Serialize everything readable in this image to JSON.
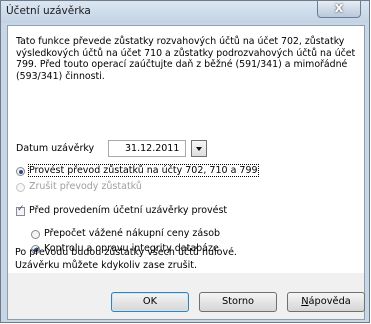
{
  "window": {
    "title": "Účetní uzávěrka",
    "close_glyph": "X"
  },
  "intro_text": "Tato funkce převede zůstatky rozvahových účtů na účet 702, zůstatky výsledkových účtů na účet 710 a zůstatky podrozvahových účtů na účet 799. Před touto operací zaúčtujte daň z běžné (591/341) a mimořádné (593/341) činnosti.",
  "date": {
    "label": "Datum uzávěrky",
    "value": "31.12.2011"
  },
  "options": {
    "transfer_label": "Provést převod zůstatků na účty 702, 710 a 799",
    "transfer_selected": true,
    "cancel_label": "Zrušit převody zůstatků",
    "cancel_enabled": false
  },
  "pre_closing": {
    "checkbox_label": "Před provedením účetní uzávěrky provést",
    "checked": true,
    "recalc_label": "Přepočet vážené nákupní ceny zásob",
    "check_db_label": "Kontrolu a opravu integrity databáze",
    "selected": "check_db"
  },
  "note": {
    "line1": "Po převodu budou zůstatky všech účtů nulové.",
    "line2": "Uzávěrku můžete kdykoliv zase zrušit."
  },
  "buttons": {
    "ok": "OK",
    "cancel": "Storno",
    "help": "Nápověda"
  }
}
